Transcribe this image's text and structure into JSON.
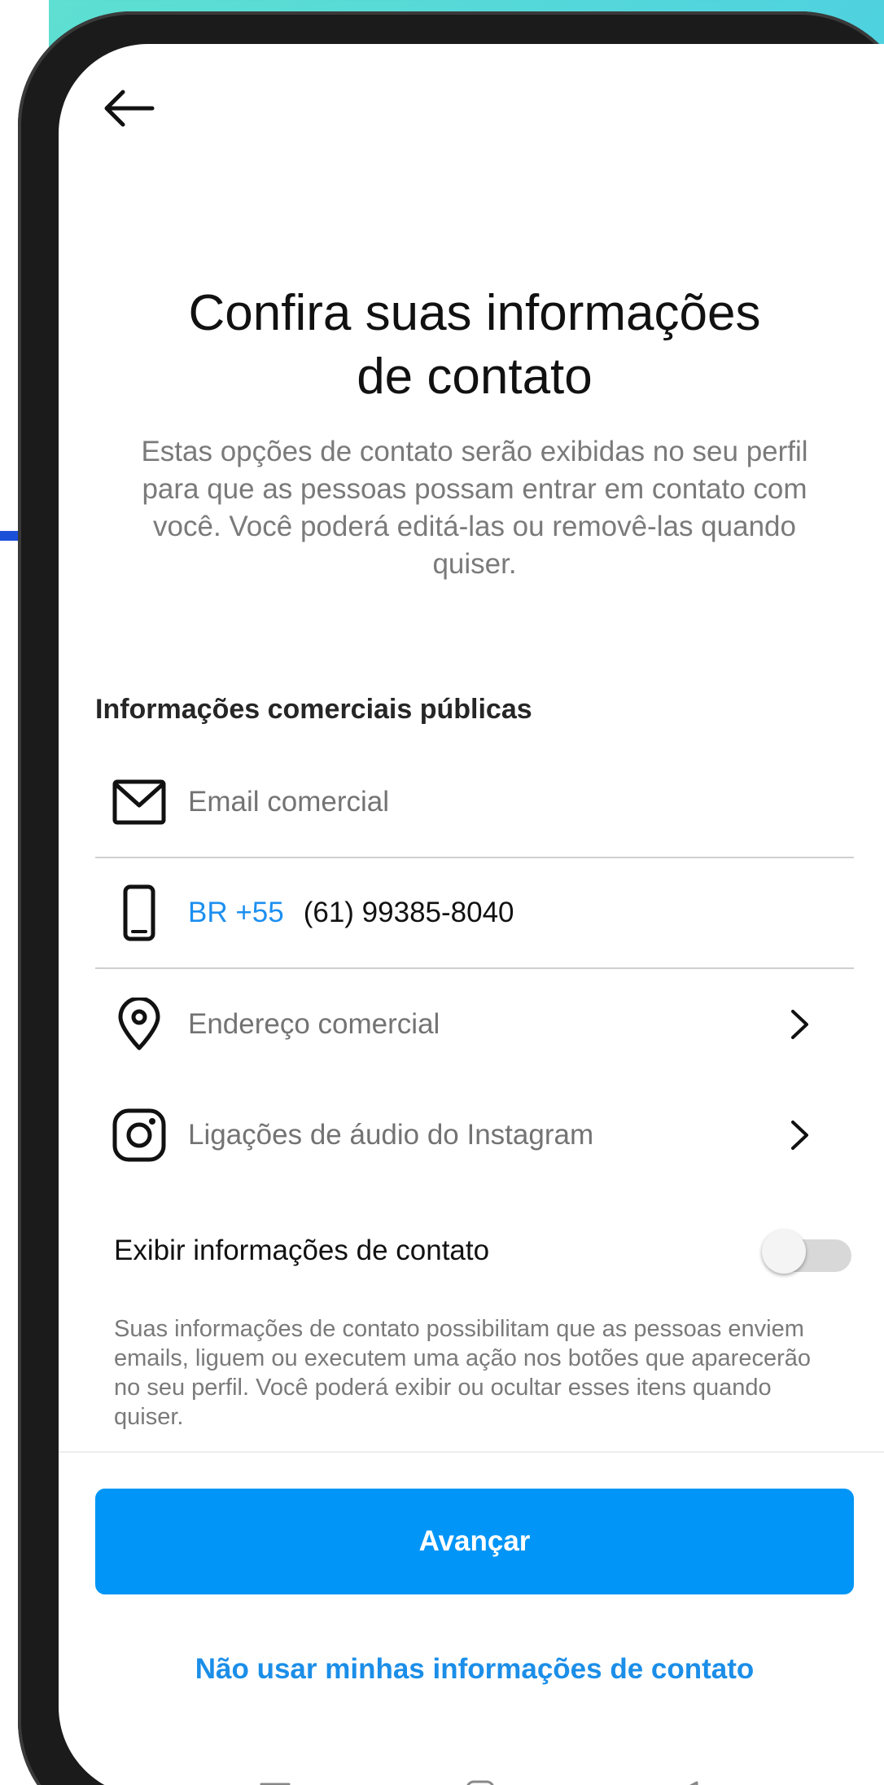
{
  "header": {
    "back_icon": "arrow-left-icon",
    "title_line1": "Confira suas informações",
    "title_line2": "de contato",
    "subtitle": "Estas opções de contato serão exibidas no seu perfil para que as pessoas possam entrar em contato com você. Você poderá editá-las ou removê-las quando quiser."
  },
  "section": {
    "title": "Informações comerciais públicas"
  },
  "fields": {
    "email": {
      "icon": "mail-icon",
      "placeholder": "Email comercial"
    },
    "phone": {
      "icon": "phone-icon",
      "country_prefix": "BR +55",
      "value": "(61) 99385-8040"
    },
    "address": {
      "icon": "location-pin-icon",
      "placeholder": "Endereço comercial"
    },
    "instagram_calls": {
      "icon": "instagram-icon",
      "label": "Ligações de áudio do Instagram"
    }
  },
  "toggle": {
    "label": "Exibir informações de contato",
    "enabled": false,
    "description": "Suas informações de contato possibilitam que as pessoas enviem emails, liguem ou executem uma ação nos botões que aparecerão no seu perfil. Você poderá exibir ou ocultar esses itens quando quiser."
  },
  "actions": {
    "primary": "Avançar",
    "secondary": "Não usar minhas informações de contato"
  },
  "colors": {
    "accent": "#0095f6",
    "link": "#1b8ee8",
    "prefix": "#1c8ff0"
  }
}
